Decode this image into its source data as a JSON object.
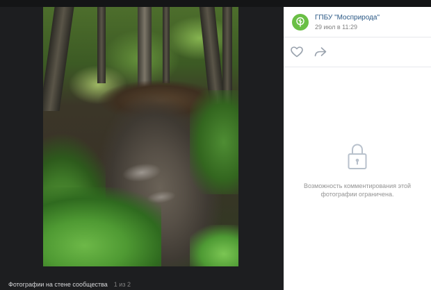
{
  "viewer": {
    "caption_title": "Фотографии на стене сообщества",
    "caption_count": "1 из 2"
  },
  "post": {
    "author": "ГПБУ \"Мосприрода\"",
    "date": "29 июл в 11:29"
  },
  "comments": {
    "restricted_text": "Возможность комментирования этой фотографии ограничена."
  },
  "icons": {
    "avatar": "tree-logo-icon",
    "like": "heart-icon",
    "share": "share-arrow-icon",
    "lock": "lock-icon"
  },
  "colors": {
    "viewer_bg": "#1d1e20",
    "link": "#2a5885",
    "avatar_green": "#6abf45",
    "muted": "#828282",
    "icon_gray": "#99a2ad",
    "lock_gray": "#b8c1cc"
  }
}
